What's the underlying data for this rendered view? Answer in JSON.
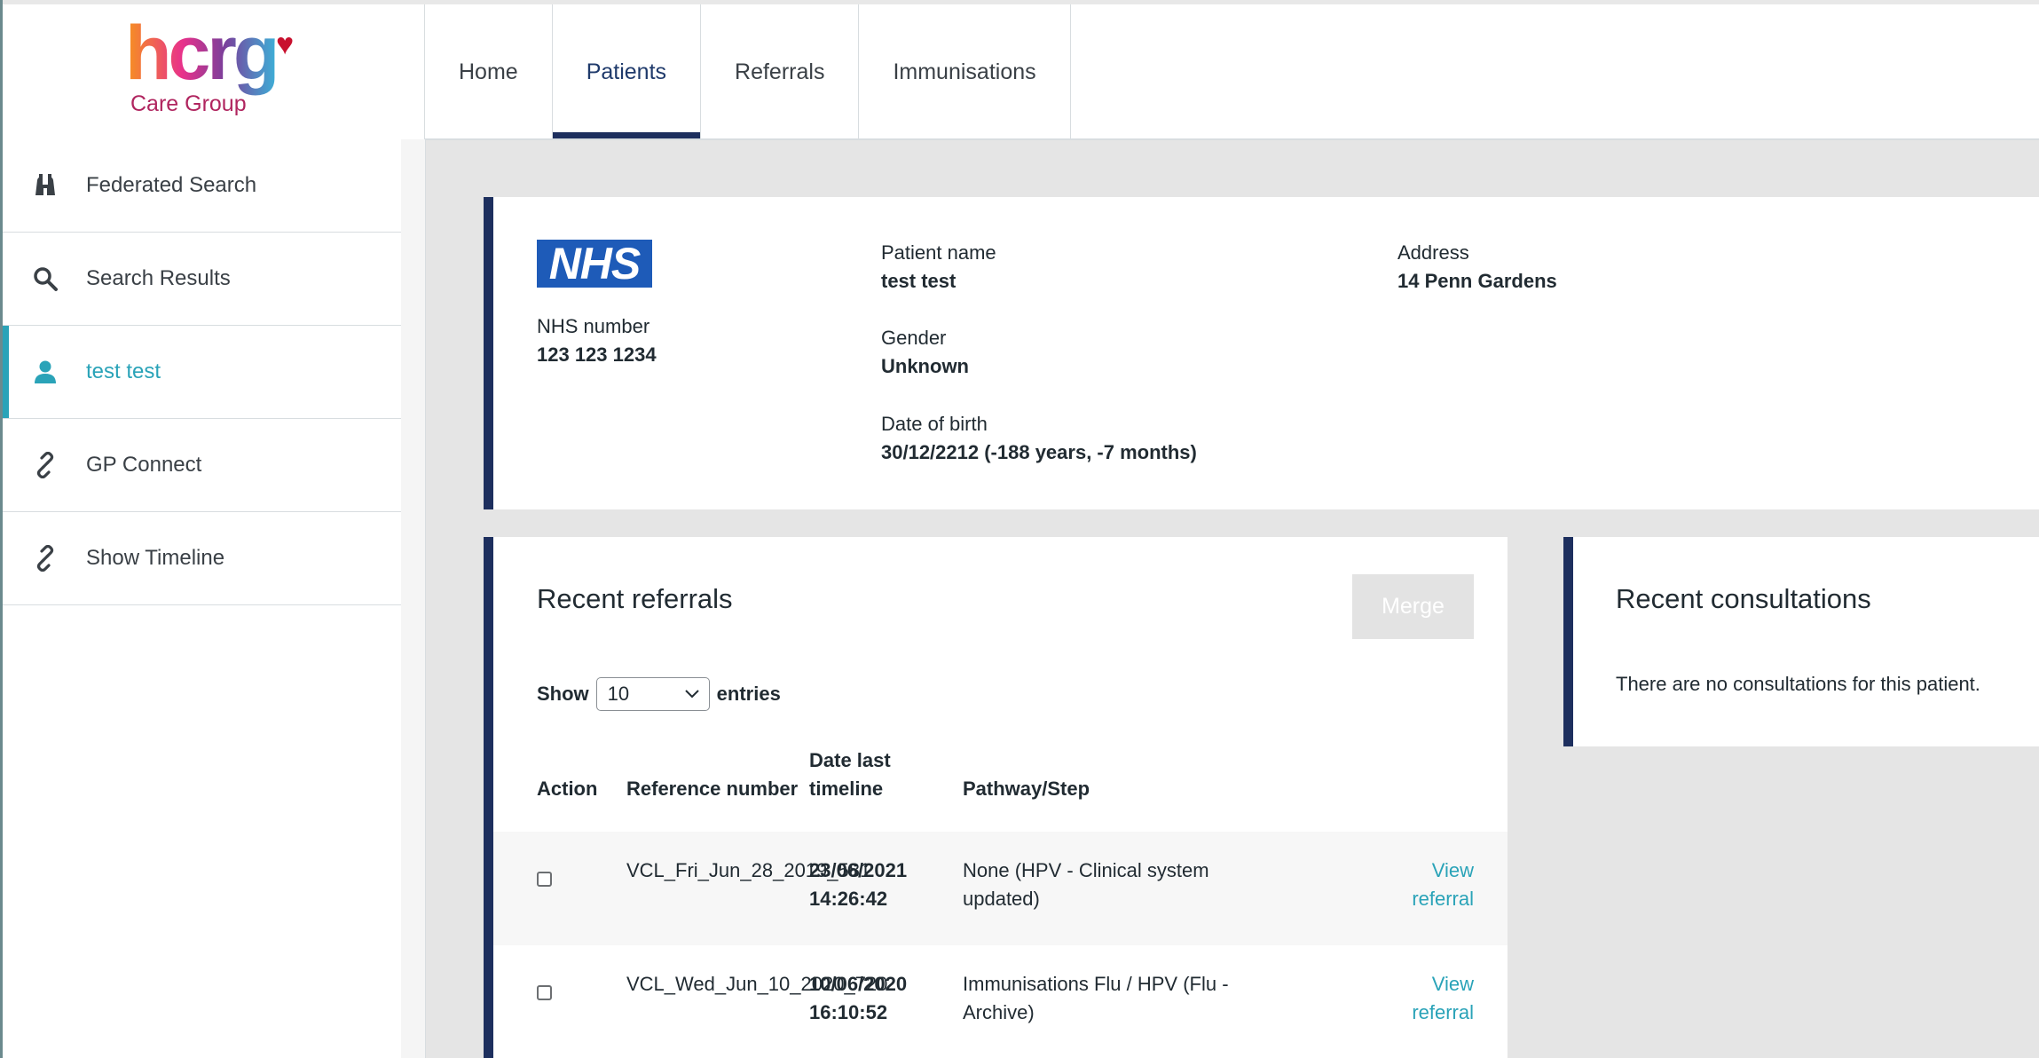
{
  "logo": {
    "main": "hcrg",
    "sub": "Care Group"
  },
  "topnav": {
    "tabs": [
      {
        "label": "Home"
      },
      {
        "label": "Patients"
      },
      {
        "label": "Referrals"
      },
      {
        "label": "Immunisations"
      }
    ],
    "active": "Patients"
  },
  "sidebar": {
    "items": [
      {
        "label": "Federated Search",
        "icon": "binoculars-icon"
      },
      {
        "label": "Search Results",
        "icon": "search-icon"
      },
      {
        "label": "test test",
        "icon": "user-icon"
      },
      {
        "label": "GP Connect",
        "icon": "link-icon"
      },
      {
        "label": "Show Timeline",
        "icon": "link-icon"
      }
    ]
  },
  "patient": {
    "nhs_logo": "NHS",
    "nhs_number_label": "NHS number",
    "nhs_number": "123 123 1234",
    "name_label": "Patient name",
    "name": "test test",
    "gender_label": "Gender",
    "gender": "Unknown",
    "dob_label": "Date of birth",
    "dob": "30/12/2212 (-188 years, -7 months)",
    "address_label": "Address",
    "address": "14 Penn Gardens"
  },
  "referrals": {
    "title": "Recent referrals",
    "merge_label": "Merge",
    "show_label": "Show",
    "entries_value": "10",
    "entries_label": "entries",
    "headers": {
      "action": "Action",
      "reference": "Reference number",
      "date_line1": "Date last",
      "date_line2": "timeline",
      "pathway": "Pathway/Step"
    },
    "rows": [
      {
        "reference": "VCL_Fri_Jun_28_2019_581",
        "date1": "23/06/2021",
        "date2": "14:26:42",
        "path1": "None (HPV - Clinical system",
        "path2": "updated)",
        "link1": "View",
        "link2": "referral"
      },
      {
        "reference": "VCL_Wed_Jun_10_2020_720",
        "date1": "10/06/2020",
        "date2": "16:10:52",
        "path1": "Immunisations Flu / HPV (Flu -",
        "path2": "Archive)",
        "link1": "View",
        "link2": "referral"
      }
    ]
  },
  "consultations": {
    "title": "Recent consultations",
    "empty": "There are no consultations for this patient."
  },
  "colors": {
    "brand_navy": "#1d2f5e",
    "accent_teal": "#2aa3b8",
    "nhs_blue": "#1e5bb8"
  }
}
